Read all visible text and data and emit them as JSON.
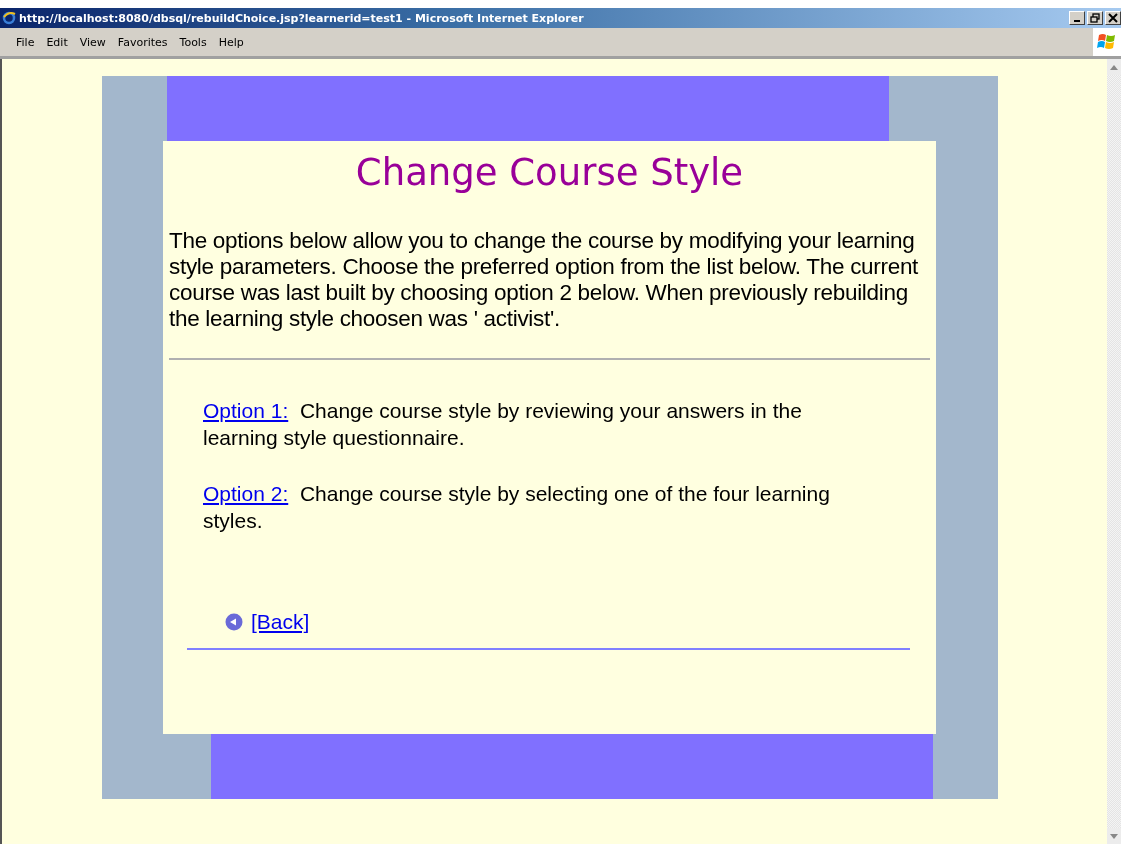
{
  "window": {
    "title": "http://localhost:8080/dbsql/rebuildChoice.jsp?learnerid=test1 - Microsoft Internet Explorer"
  },
  "menu": [
    {
      "label": "File"
    },
    {
      "label": "Edit"
    },
    {
      "label": "View"
    },
    {
      "label": "Favorites"
    },
    {
      "label": "Tools"
    },
    {
      "label": "Help"
    }
  ],
  "page": {
    "heading": "Change Course Style",
    "intro": "The options below allow you to change the course by modifying your learning style parameters. Choose the preferred option from the list below. The current course was last built by choosing option 2 below. When previously rebuilding the learning style choosen was ' activist'.",
    "options": [
      {
        "link": "Option 1:",
        "text": "Change course style by reviewing your answers in the learning style questionnaire."
      },
      {
        "link": "Option 2:",
        "text": "Change course style by selecting one of the four learning styles."
      }
    ],
    "back": "[Back]"
  }
}
